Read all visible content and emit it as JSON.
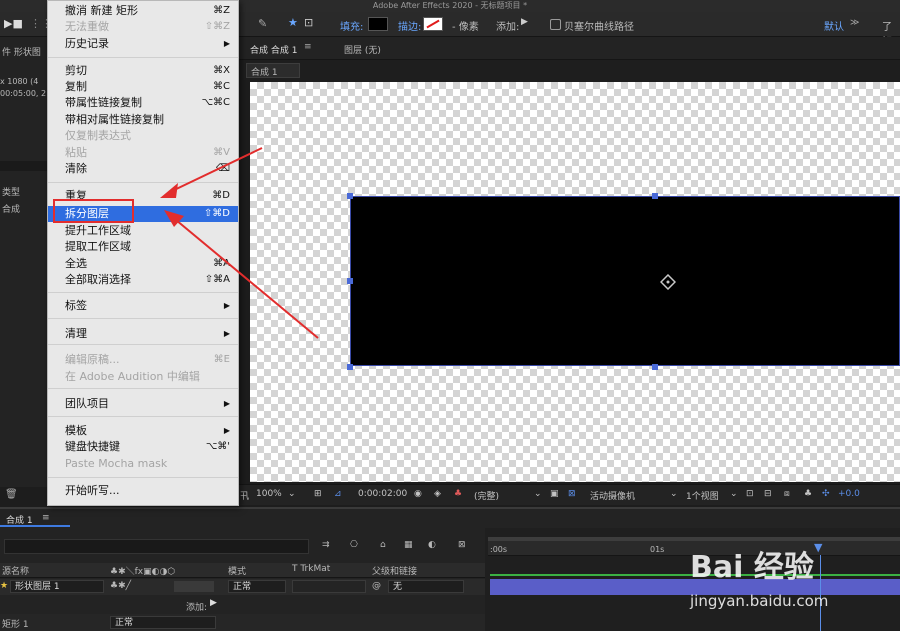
{
  "window": {
    "title": "Adobe After Effects 2020 - 无标题项目 *"
  },
  "toolbar": {
    "fill_label": "填充:",
    "stroke_label": "描边:",
    "px_label": "- 像素",
    "add_label": "添加:",
    "bezier_label": "贝塞尔曲线路径",
    "default_label": "默认",
    "more_label": "了解"
  },
  "left_panel": {
    "title": "件  形状图",
    "res": "x 1080 (4",
    "dur": "00:05:00, 2",
    "type_header": "类型",
    "type_value": "合成"
  },
  "comp": {
    "tab_label": "合成  合成 1",
    "layer_label": "图层  (无)",
    "sub_tab": "合成 1"
  },
  "menu": {
    "items": [
      {
        "label": "撤消 新建 矩形",
        "shortcut": "⌘Z",
        "state": "normal"
      },
      {
        "label": "无法重做",
        "shortcut": "⇧⌘Z",
        "state": "disabled"
      },
      {
        "label": "历史记录",
        "shortcut": "▶",
        "state": "normal"
      },
      {
        "label": "剪切",
        "shortcut": "⌘X",
        "state": "normal"
      },
      {
        "label": "复制",
        "shortcut": "⌘C",
        "state": "normal"
      },
      {
        "label": "带属性链接复制",
        "shortcut": "⌥⌘C",
        "state": "normal"
      },
      {
        "label": "带相对属性链接复制",
        "shortcut": "",
        "state": "normal"
      },
      {
        "label": "仅复制表达式",
        "shortcut": "",
        "state": "disabled"
      },
      {
        "label": "粘贴",
        "shortcut": "⌘V",
        "state": "disabled"
      },
      {
        "label": "清除",
        "shortcut": "⌫",
        "state": "normal"
      },
      {
        "label": "重复",
        "shortcut": "⌘D",
        "state": "normal"
      },
      {
        "label": "拆分图层",
        "shortcut": "⇧⌘D",
        "state": "highlighted"
      },
      {
        "label": "提升工作区域",
        "shortcut": "",
        "state": "normal"
      },
      {
        "label": "提取工作区域",
        "shortcut": "",
        "state": "normal"
      },
      {
        "label": "全选",
        "shortcut": "⌘A",
        "state": "normal"
      },
      {
        "label": "全部取消选择",
        "shortcut": "⇧⌘A",
        "state": "normal"
      },
      {
        "label": "标签",
        "shortcut": "▶",
        "state": "normal"
      },
      {
        "label": "清理",
        "shortcut": "▶",
        "state": "normal"
      },
      {
        "label": "编辑原稿...",
        "shortcut": "⌘E",
        "state": "disabled"
      },
      {
        "label": "在 Adobe Audition 中编辑",
        "shortcut": "",
        "state": "disabled"
      },
      {
        "label": "团队项目",
        "shortcut": "▶",
        "state": "normal"
      },
      {
        "label": "模板",
        "shortcut": "▶",
        "state": "normal"
      },
      {
        "label": "键盘快捷键",
        "shortcut": "⌥⌘'",
        "state": "normal"
      },
      {
        "label": "Paste Mocha mask",
        "shortcut": "",
        "state": "disabled"
      },
      {
        "label": "开始听写...",
        "shortcut": "",
        "state": "normal"
      }
    ]
  },
  "viewer_bar": {
    "zoom": "100%",
    "timecode": "0:00:02:00",
    "quality": "(完整)",
    "camera": "活动摄像机",
    "views": "1个视图",
    "exposure": "+0.0"
  },
  "timeline": {
    "tab_label": "合成 1",
    "col_source": "源名称",
    "col_mode": "模式",
    "col_trkmat": "T  TrkMat",
    "col_parent": "父级和链接",
    "layer_name": "形状图层 1",
    "layer_mode": "正常",
    "layer_parent": "无",
    "add_label": "添加:",
    "sub_name": "矩形 1",
    "sub_mode": "正常",
    "ruler_0": ":00s",
    "ruler_1": "01s"
  },
  "watermark": {
    "brand": "Bai 经验",
    "url": "jingyan.baidu.com"
  }
}
